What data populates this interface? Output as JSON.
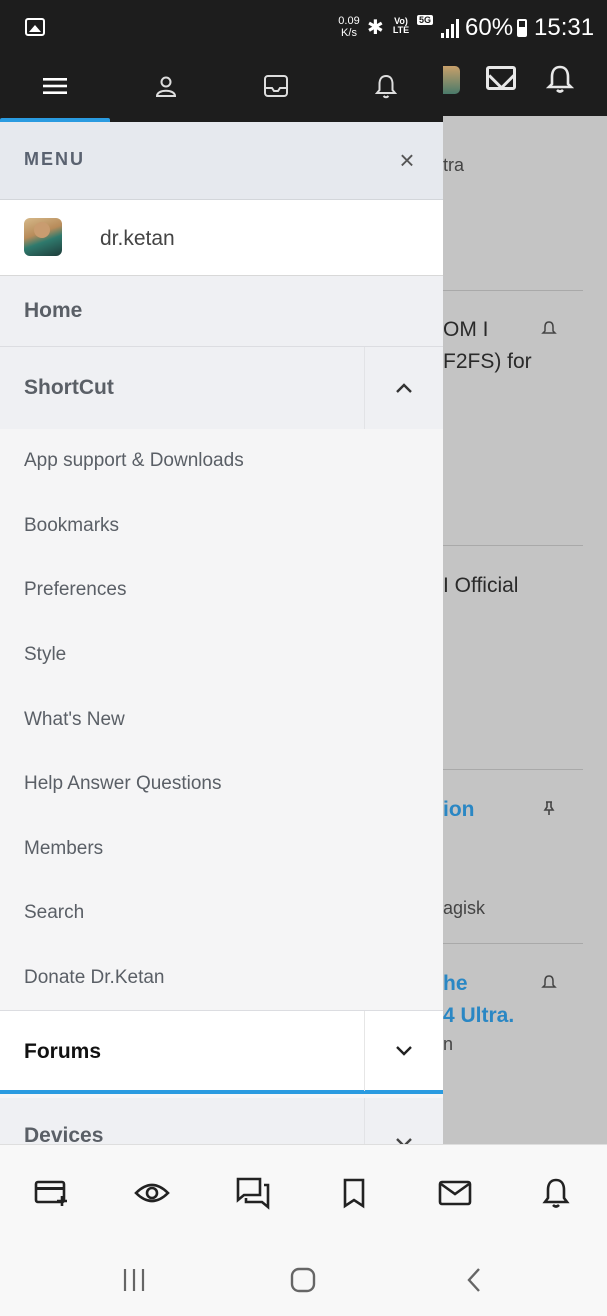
{
  "status_bar": {
    "net_speed_value": "0.09",
    "net_speed_unit": "K/s",
    "volte_top": "Vo)",
    "volte_bottom": "LTE",
    "network": "5G",
    "battery": "60%",
    "time": "15:31"
  },
  "drawer": {
    "title": "MENU",
    "close_glyph": "×",
    "user_name": "dr.ketan",
    "home_label": "Home",
    "shortcut_label": "ShortCut",
    "shortcut_items": [
      "App support & Downloads",
      "Bookmarks",
      "Preferences",
      "Style",
      "What's New",
      "Help Answer Questions",
      "Members",
      "Search",
      "Donate Dr.Ketan"
    ],
    "forums_label": "Forums",
    "devices_label": "Devices"
  },
  "background": {
    "texts": [
      "tra",
      "OM I",
      "F2FS) for",
      "I Official",
      "ion",
      "agisk",
      "he",
      "4 Ultra.",
      "n"
    ]
  },
  "colors": {
    "accent": "#2a9be0",
    "dark_bar": "#1d1d1d",
    "link": "#2a87c4"
  },
  "icons": {
    "drawer_nav": [
      "menu-icon",
      "user-icon",
      "inbox-icon",
      "bell-icon"
    ],
    "tabbar": [
      "new-thread-icon",
      "watched-icon",
      "conversations-icon",
      "bookmark-icon",
      "mail-icon",
      "bell-icon"
    ],
    "system_nav": [
      "recents-icon",
      "home-icon",
      "back-icon"
    ]
  }
}
